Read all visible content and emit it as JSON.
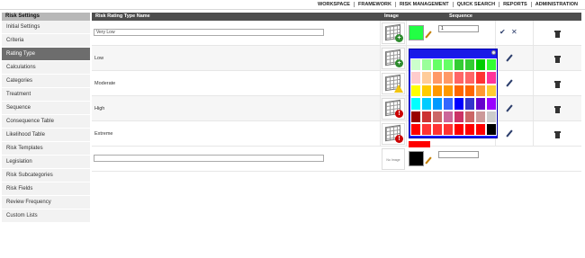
{
  "topnav": [
    "WORKSPACE",
    "FRAMEWORK",
    "RISK MANAGEMENT",
    "QUICK SEARCH",
    "REPORTS",
    "ADMINISTRATION"
  ],
  "sidebar": {
    "header": "Risk Settings",
    "items": [
      {
        "label": "Initial Settings",
        "active": false
      },
      {
        "label": "Criteria",
        "active": false
      },
      {
        "label": "Rating Type",
        "active": true
      },
      {
        "label": "Calculations",
        "active": false
      },
      {
        "label": "Categories",
        "active": false
      },
      {
        "label": "Treatment",
        "active": false
      },
      {
        "label": "Sequence",
        "active": false
      },
      {
        "label": "Consequence Table",
        "active": false
      },
      {
        "label": "Likelihood Table",
        "active": false
      },
      {
        "label": "Risk Templates",
        "active": false
      },
      {
        "label": "Legislation",
        "active": false
      },
      {
        "label": "Risk Subcategories",
        "active": false
      },
      {
        "label": "Risk Fields",
        "active": false
      },
      {
        "label": "Review Frequency",
        "active": false
      },
      {
        "label": "Custom Lists",
        "active": false
      }
    ]
  },
  "grid": {
    "headers": {
      "name": "Risk Rating Type Name",
      "image": "Image",
      "sequence": "Sequence"
    },
    "rows": [
      {
        "name": "Very Low",
        "editing": true,
        "color": "#22ff44",
        "sequence": "1",
        "badge": "plus-green"
      },
      {
        "name": "Low",
        "editing": false,
        "badge": "plus-green"
      },
      {
        "name": "Moderate",
        "editing": false,
        "badge": "warning-yellow"
      },
      {
        "name": "High",
        "editing": false,
        "badge": "stop-red"
      },
      {
        "name": "Extreme",
        "editing": false,
        "badge": "stop-red"
      }
    ],
    "new_row": {
      "name": "",
      "image_text": "No Image",
      "color": "#000000",
      "sequence": ""
    }
  },
  "palette": {
    "colors": [
      "#ccffcc",
      "#99ff99",
      "#66ff66",
      "#66ff66",
      "#33cc33",
      "#33cc33",
      "#00cc00",
      "#33ff33",
      "#ffcccc",
      "#ffcc99",
      "#ff9966",
      "#ff9966",
      "#ff6666",
      "#ff6666",
      "#ff3333",
      "#ff3399",
      "#ffff00",
      "#ffcc00",
      "#ff9900",
      "#ff9900",
      "#ff6600",
      "#ff6600",
      "#ff9933",
      "#ffcc33",
      "#00ffff",
      "#00ccff",
      "#0099ff",
      "#3366ff",
      "#0000ff",
      "#3333cc",
      "#6600cc",
      "#9900ff",
      "#990000",
      "#cc3333",
      "#cc6666",
      "#cc6699",
      "#cc3366",
      "#cc6666",
      "#cc9999",
      "#cccccc",
      "#ff0000",
      "#ff3333",
      "#ff3333",
      "#ff3333",
      "#ff0000",
      "#ff0000",
      "#ff0000",
      "#000000"
    ],
    "preview": "#ff0000"
  }
}
